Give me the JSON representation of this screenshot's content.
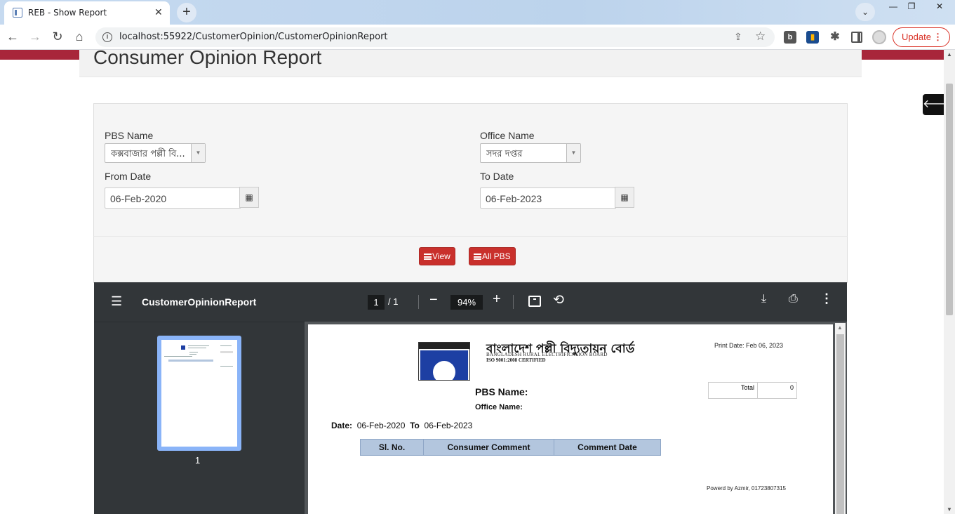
{
  "browser": {
    "tab_title": "REB - Show Report",
    "url": "localhost:55922/CustomerOpinion/CustomerOpinionReport",
    "update_label": "Update"
  },
  "page": {
    "title": "Consumer Opinion Report"
  },
  "form": {
    "pbs_label": "PBS Name",
    "pbs_value": "কক্সবাজার পল্লী বি...",
    "office_label": "Office Name",
    "office_value": "সদর দপ্তর",
    "from_label": "From Date",
    "from_value": "06-Feb-2020",
    "to_label": "To Date",
    "to_value": "06-Feb-2023",
    "view_button": "View",
    "all_pbs_button": "All PBS"
  },
  "pdf_viewer": {
    "title": "CustomerOpinionReport",
    "current_page": "1",
    "page_of": "/  1",
    "zoom": "94%",
    "thumb_label": "1"
  },
  "report": {
    "org_name_bn": "বাংলাদেশ পল্লী বিদ্যুতায়ন বোর্ড",
    "org_name_en": "BANGLADESH RURAL ELECTRIFICATION BOARD",
    "iso": "ISO 9001:2008 CERTIFIED",
    "print_date": "Print Date:  Feb 06, 2023",
    "total_label": "Total",
    "total_value": "0",
    "pbs_name_label": "PBS Name:",
    "office_name_label": "Office Name:",
    "date_label": "Date:",
    "date_from": "06-Feb-2020",
    "to_label": "To",
    "date_to": "06-Feb-2023",
    "columns": [
      "Sl. No.",
      "Consumer Comment",
      "Comment Date"
    ],
    "powered_by": "Powerd by Azmir, 01723807315"
  },
  "icons": {
    "calendar": "calendar-icon",
    "list": "list-icon",
    "hamburger": "menu-icon",
    "download": "download-icon",
    "print": "print-icon",
    "more": "more-vert-icon",
    "rotate": "rotate-icon",
    "fit": "fit-page-icon",
    "back_arrow": "arrow-left-icon"
  },
  "colors": {
    "brand_red": "#c9302c",
    "header_red": "#a8263a",
    "table_header": "#b3c6de",
    "pdf_toolbar": "#323639"
  }
}
